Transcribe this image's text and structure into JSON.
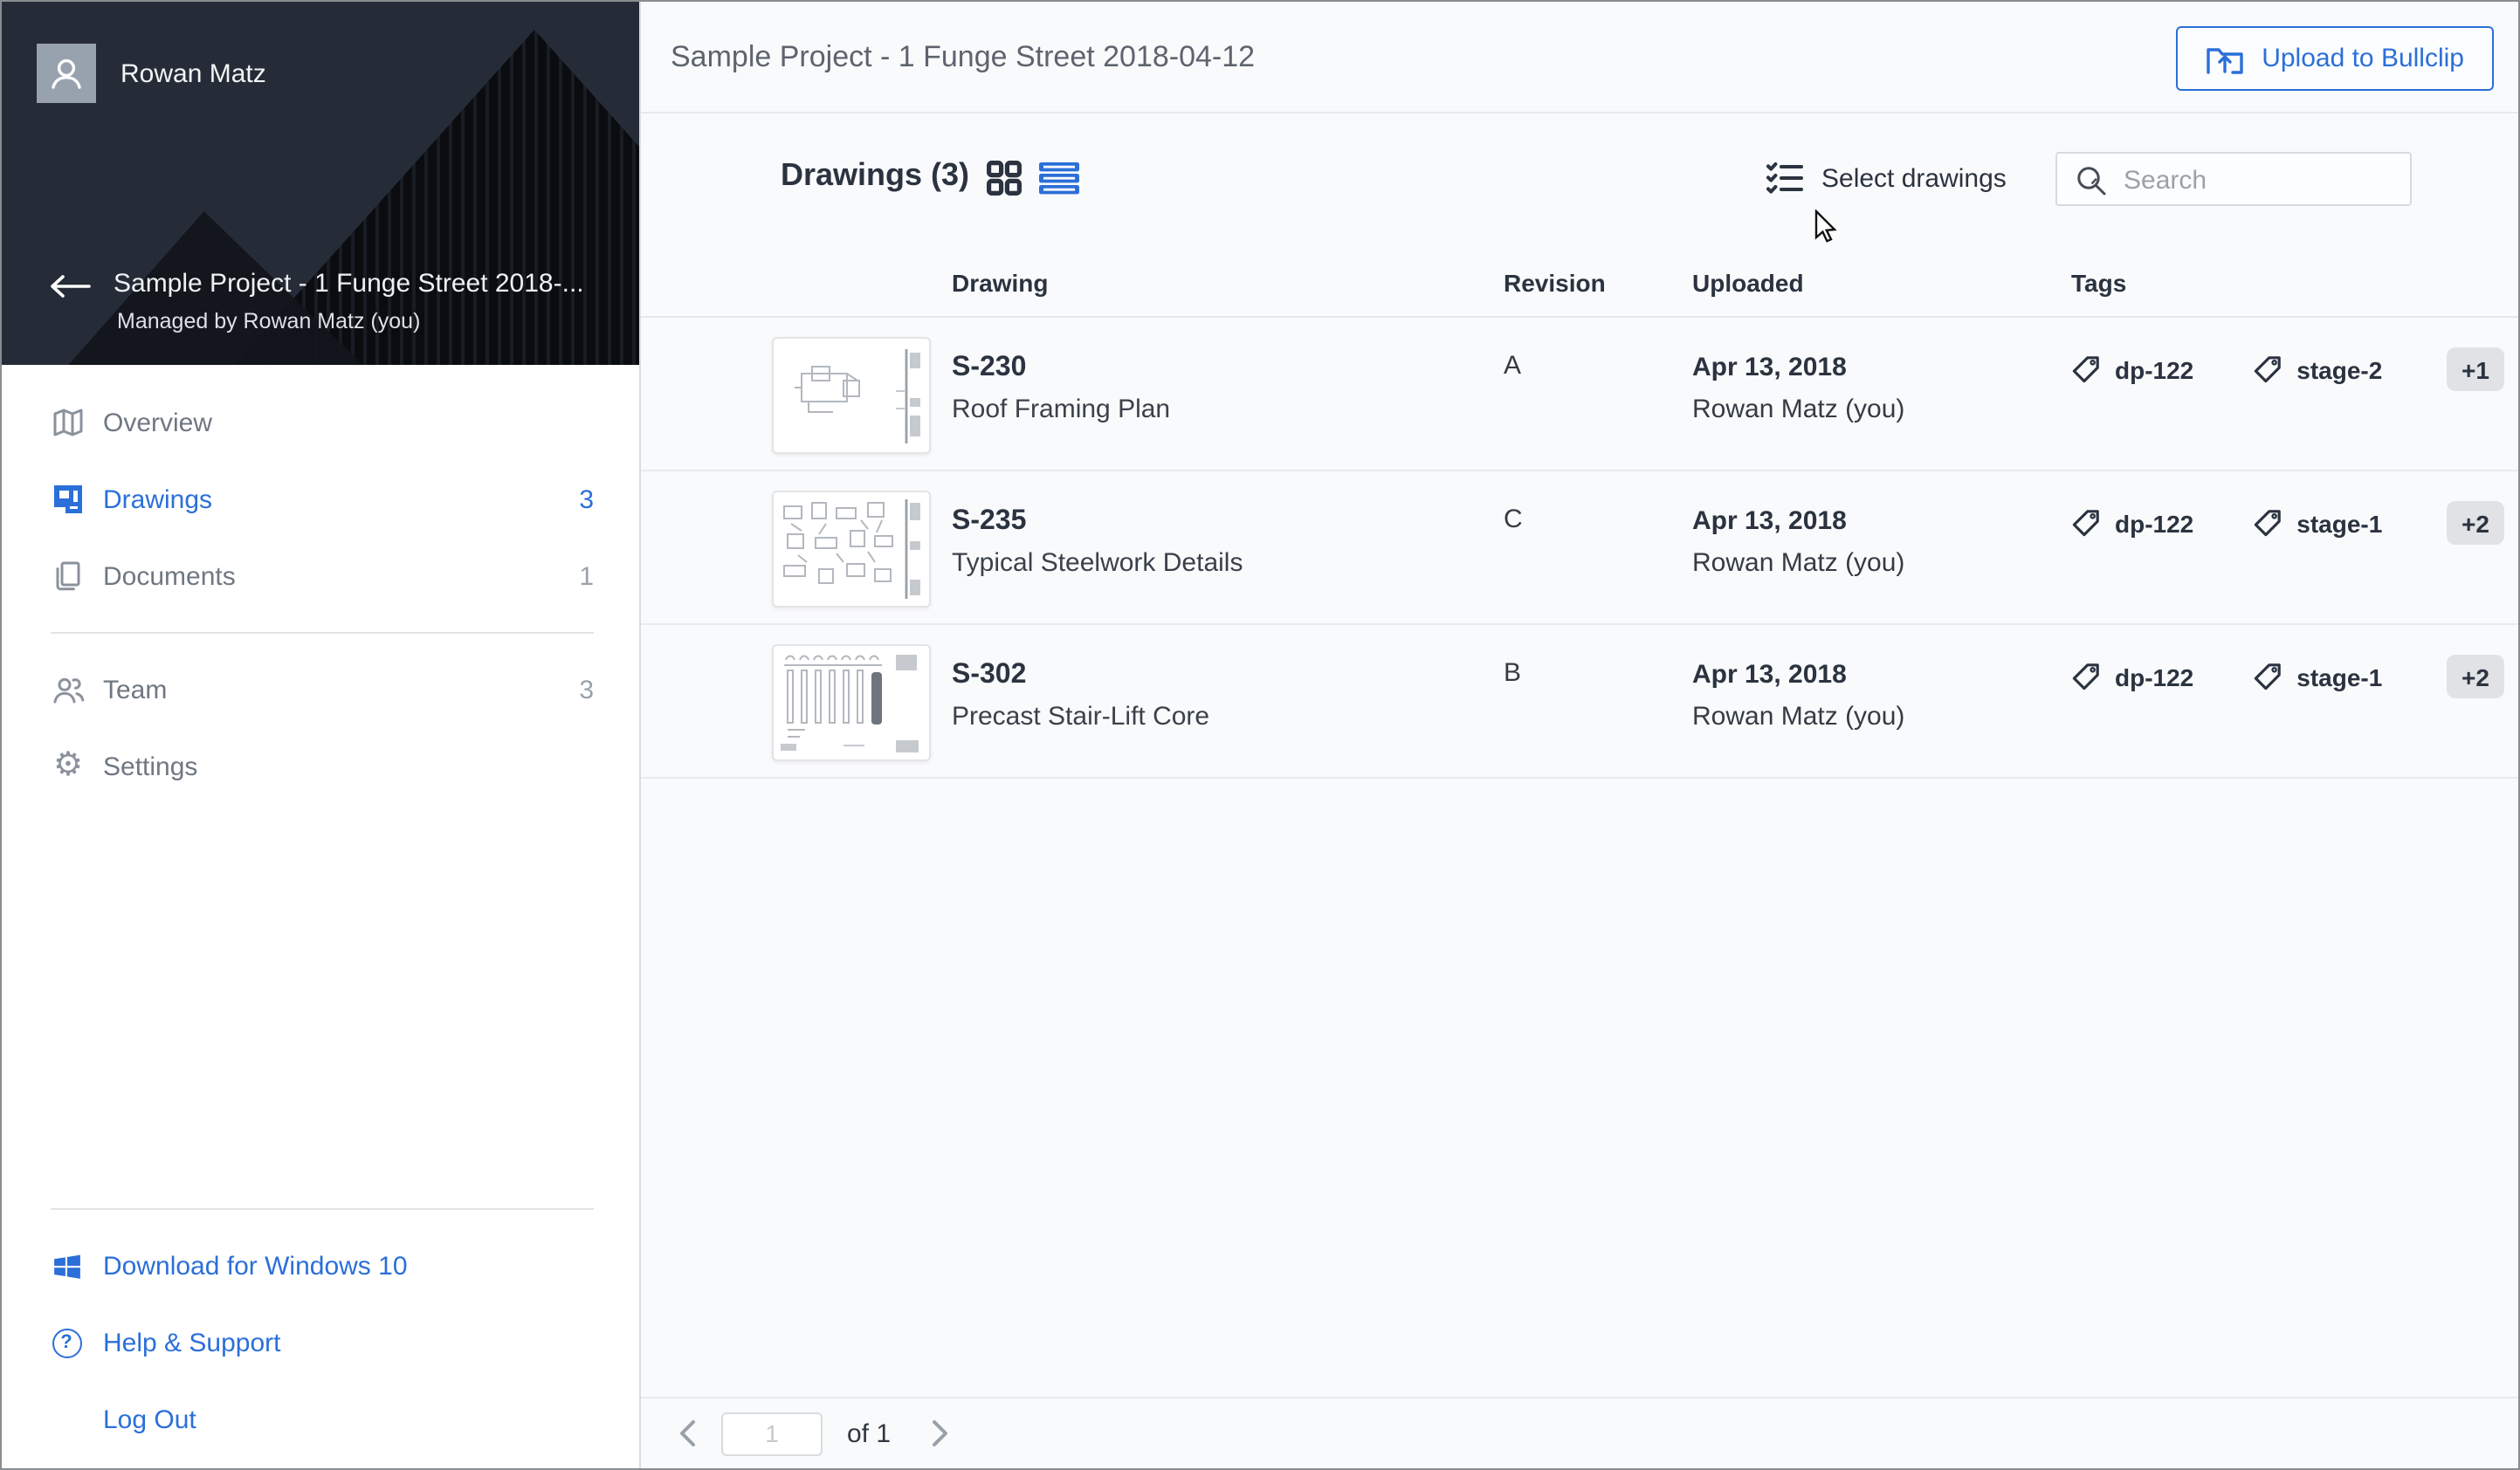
{
  "colors": {
    "accent": "#2b6fd9",
    "header_dark": "#262c37",
    "text_dark": "#2b3340",
    "badge_bg": "#e0e2e5"
  },
  "sidebar": {
    "user": {
      "name": "Rowan Matz"
    },
    "project": {
      "title": "Sample Project - 1 Funge Street 2018-...",
      "subtitle": "Managed by Rowan Matz (you)"
    },
    "nav": [
      {
        "id": "overview",
        "label": "Overview",
        "count": ""
      },
      {
        "id": "drawings",
        "label": "Drawings",
        "count": "3"
      },
      {
        "id": "documents",
        "label": "Documents",
        "count": "1"
      },
      {
        "id": "team",
        "label": "Team",
        "count": "3"
      },
      {
        "id": "settings",
        "label": "Settings",
        "count": ""
      }
    ],
    "footer": [
      {
        "id": "download",
        "label": "Download for Windows 10"
      },
      {
        "id": "help",
        "label": "Help & Support"
      },
      {
        "id": "logout",
        "label": "Log Out"
      }
    ]
  },
  "topbar": {
    "title": "Sample Project - 1 Funge Street 2018-04-12",
    "upload_label": "Upload to Bullclip"
  },
  "toolbar": {
    "heading": "Drawings (3)",
    "select_label": "Select drawings",
    "search_placeholder": "Search"
  },
  "table": {
    "columns": [
      "Drawing",
      "Revision",
      "Uploaded",
      "Tags"
    ],
    "rows": [
      {
        "code": "S-230",
        "title": "Roof Framing Plan",
        "revision": "A",
        "uploaded_date": "Apr 13, 2018",
        "uploaded_by": "Rowan Matz (you)",
        "tags": [
          "dp-122",
          "stage-2"
        ],
        "more_count": "+1"
      },
      {
        "code": "S-235",
        "title": "Typical Steelwork Details",
        "revision": "C",
        "uploaded_date": "Apr 13, 2018",
        "uploaded_by": "Rowan Matz (you)",
        "tags": [
          "dp-122",
          "stage-1"
        ],
        "more_count": "+2"
      },
      {
        "code": "S-302",
        "title": "Precast Stair-Lift Core",
        "revision": "B",
        "uploaded_date": "Apr 13, 2018",
        "uploaded_by": "Rowan Matz (you)",
        "tags": [
          "dp-122",
          "stage-1"
        ],
        "more_count": "+2"
      }
    ]
  },
  "pagination": {
    "page_value": "1",
    "of_label": "of 1"
  }
}
